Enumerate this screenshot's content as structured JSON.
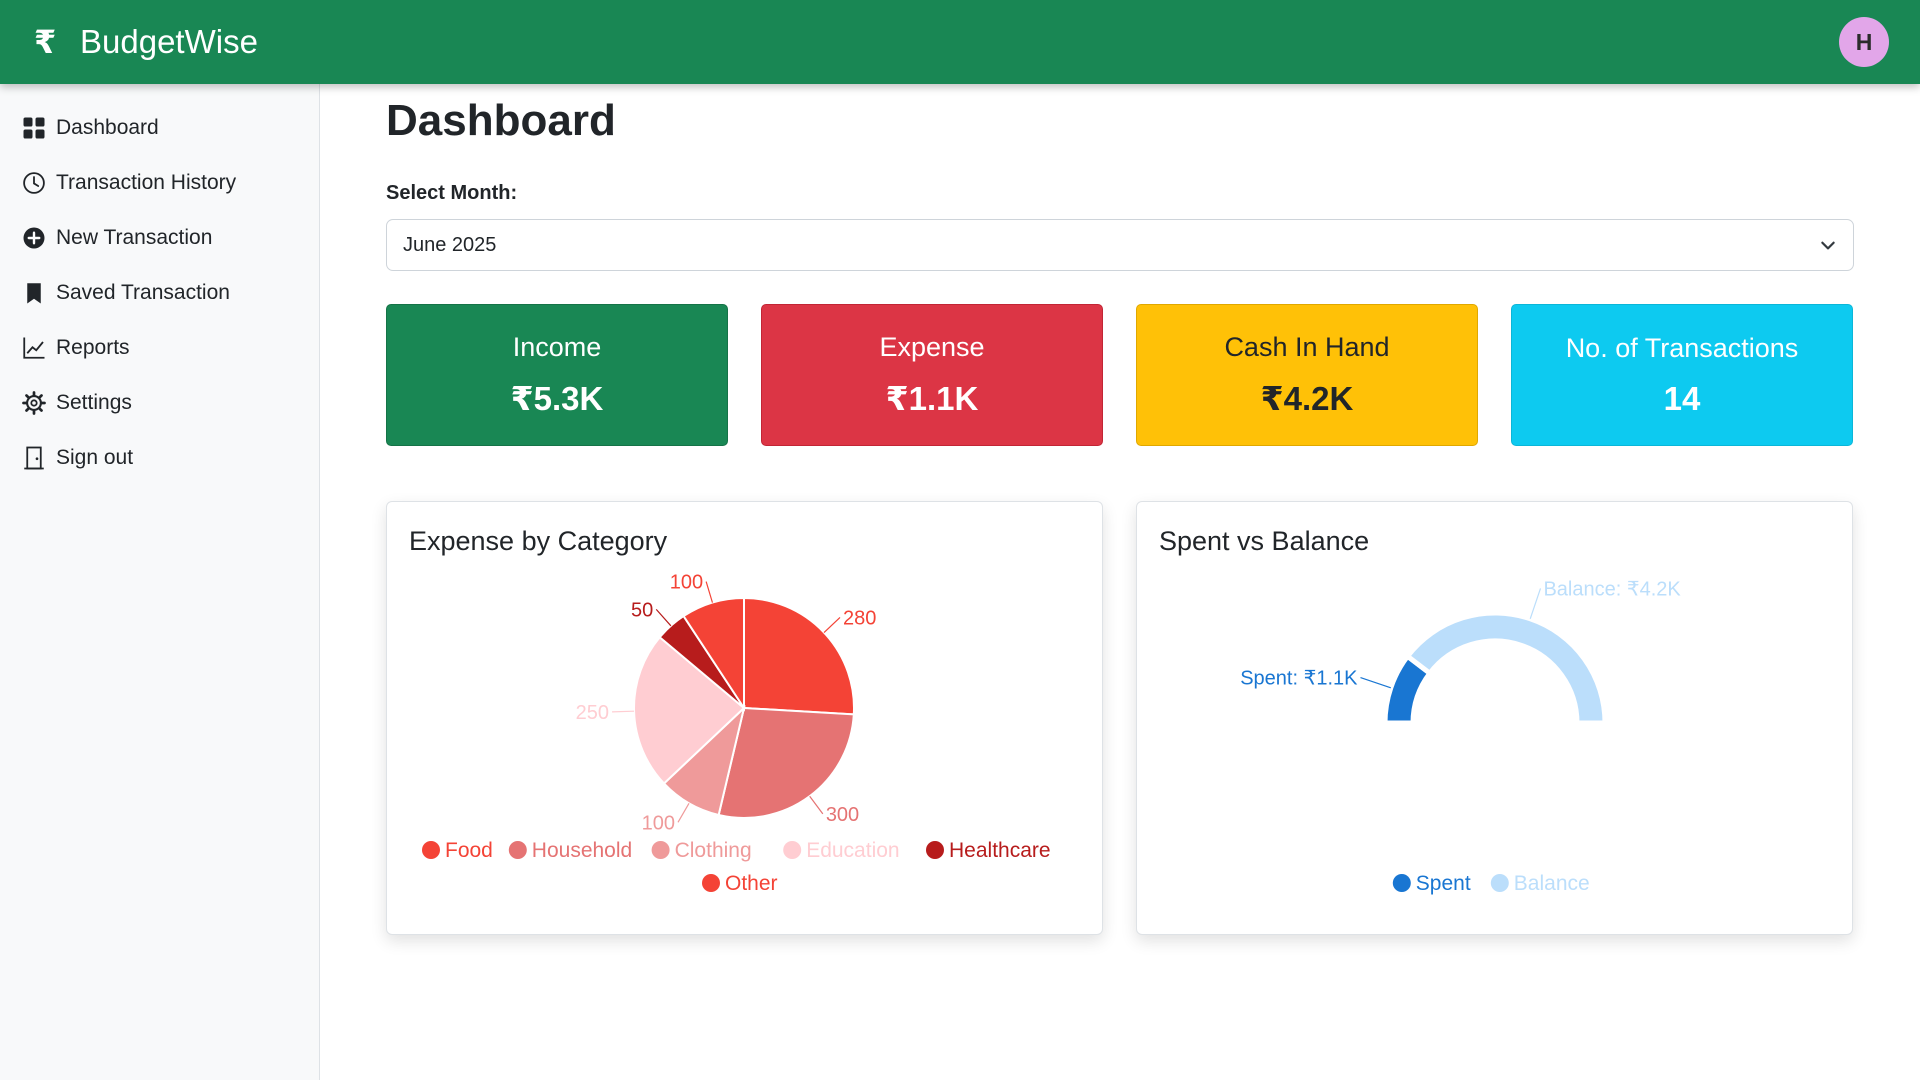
{
  "app": {
    "name": "BudgetWise",
    "logo_icon": "rupee-icon",
    "user_initial": "H"
  },
  "sidebar": {
    "items": [
      {
        "label": "Dashboard",
        "icon": "grid-icon"
      },
      {
        "label": "Transaction History",
        "icon": "clock-icon"
      },
      {
        "label": "New Transaction",
        "icon": "plus-circle-icon"
      },
      {
        "label": "Saved Transaction",
        "icon": "bookmark-icon"
      },
      {
        "label": "Reports",
        "icon": "line-chart-icon"
      },
      {
        "label": "Settings",
        "icon": "gear-icon"
      },
      {
        "label": "Sign out",
        "icon": "door-icon"
      }
    ]
  },
  "main": {
    "title": "Dashboard",
    "month_label": "Select Month:",
    "month_value": "June 2025",
    "stats": [
      {
        "title": "Income",
        "value": "₹5.3K",
        "color": "#198754"
      },
      {
        "title": "Expense",
        "value": "₹1.1K",
        "color": "#dc3545"
      },
      {
        "title": "Cash In Hand",
        "value": "₹4.2K",
        "color": "#ffc107"
      },
      {
        "title": "No. of Transactions",
        "value": "14",
        "color": "#0dcaf0"
      }
    ]
  },
  "chart_data": [
    {
      "type": "pie",
      "title": "Expense by Category",
      "categories": [
        "Food",
        "Household",
        "Clothing",
        "Education",
        "Healthcare",
        "Other"
      ],
      "values": [
        280,
        300,
        100,
        250,
        50,
        100
      ],
      "colors": [
        "#f44336",
        "#e57373",
        "#ef9a9a",
        "#ffcdd2",
        "#b71c1c",
        "#f44336"
      ],
      "legend": "bottom"
    },
    {
      "type": "pie",
      "subtype": "semi-donut",
      "title": "Spent vs Balance",
      "categories": [
        "Spent",
        "Balance"
      ],
      "values": [
        1.1,
        4.2
      ],
      "data_labels": [
        "Spent: ₹1.1K",
        "Balance: ₹4.2K"
      ],
      "colors": [
        "#1976d2",
        "#bbdefb"
      ],
      "legend": "bottom"
    }
  ]
}
